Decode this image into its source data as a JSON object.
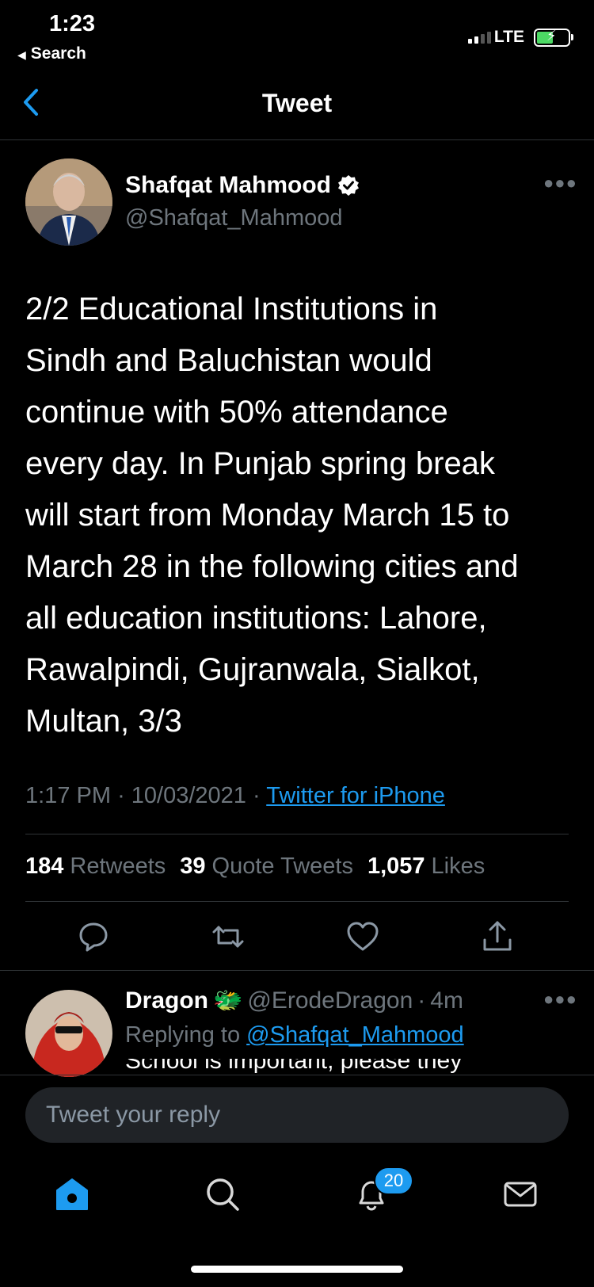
{
  "status_bar": {
    "time": "1:23",
    "back_app": "Search",
    "network": "LTE"
  },
  "header": {
    "title": "Tweet"
  },
  "tweet": {
    "author_name": "Shafqat Mahmood",
    "author_handle": "@Shafqat_Mahmood",
    "verified": true,
    "text": "2/2 Educational Institutions in\nSindh and Baluchistan would\ncontinue with 50% attendance\nevery day. In Punjab spring break\nwill start from Monday March 15 to\nMarch 28 in the following cities and\nall education institutions: Lahore,\nRawalpindi, Gujranwala, Sialkot,\nMultan, 3/3",
    "time": "1:17 PM",
    "date": "10/03/2021",
    "separator": "·",
    "source": "Twitter for iPhone",
    "stats": {
      "retweets_count": "184",
      "retweets_label": "Retweets",
      "quotes_count": "39",
      "quotes_label": "Quote Tweets",
      "likes_count": "1,057",
      "likes_label": "Likes"
    }
  },
  "reply": {
    "name": "Dragon",
    "emoji": "🐲",
    "handle": "@ErodeDragon",
    "separator": "·",
    "age": "4m",
    "replying_prefix": "Replying to",
    "replying_to": "@Shafqat_Mahmood",
    "text_partial": "School is important, please they"
  },
  "compose": {
    "placeholder": "Tweet your reply"
  },
  "tab_bar": {
    "notifications_badge": "20"
  },
  "colors": {
    "accent": "#1d9bf0",
    "muted": "#6e767d",
    "divider": "#2f3336",
    "battery": "#4cd964"
  },
  "icons": [
    "chevron-left-icon",
    "verified-icon",
    "more-icon",
    "reply-icon",
    "retweet-icon",
    "like-icon",
    "share-icon",
    "home-icon",
    "search-icon",
    "notifications-icon",
    "messages-icon"
  ]
}
